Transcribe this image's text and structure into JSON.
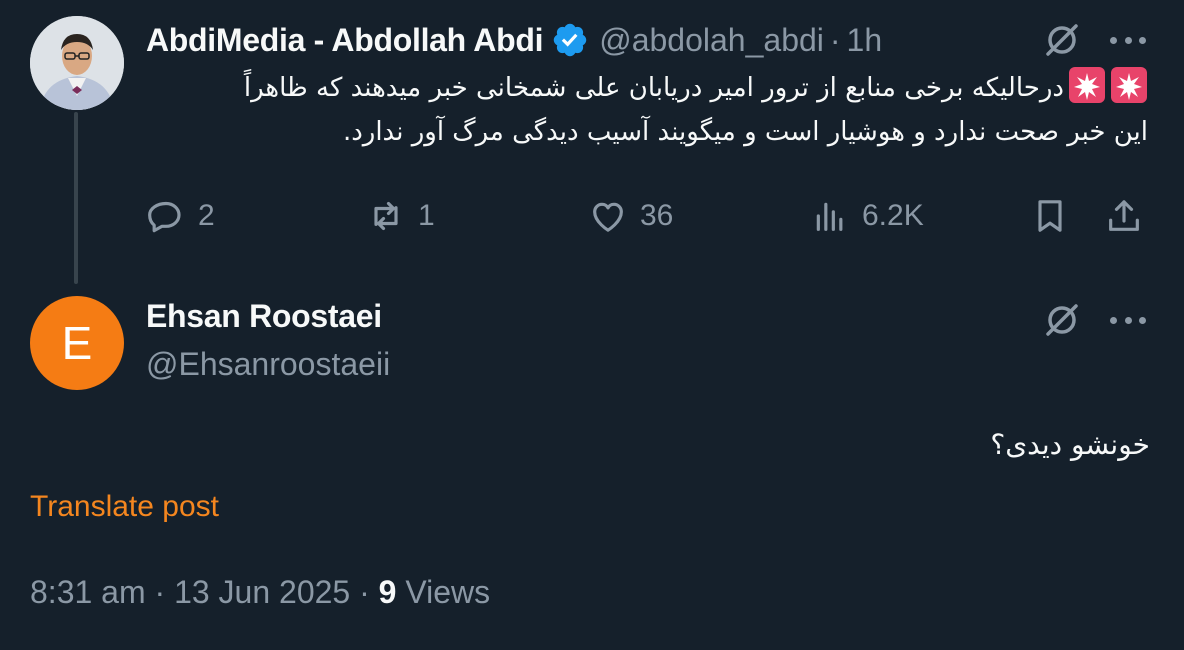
{
  "tweet": {
    "author_name": "AbdiMedia - Abdollah Abdi",
    "handle": "@abdolah_abdi",
    "separator": "·",
    "time": "1h",
    "text_line1": "درحالیکه برخی منابع از ترور امیر دریابان علی شمخانی خبر میدهند که ظاهراً",
    "text_line2": "این خبر صحت ندارد و  هوشیار است و میگویند آسیب دیدگی مرگ آور ندارد.",
    "emoji": "siren-emoji",
    "actions": {
      "replies": "2",
      "reposts": "1",
      "likes": "36",
      "views": "6.2K"
    }
  },
  "reply": {
    "avatar_letter": "E",
    "author_name": "Ehsan Roostaei",
    "handle": "@Ehsanroostaeii",
    "text": "خونشو دیدی؟",
    "translate_label": "Translate post",
    "timestamp": "8:31 am · 13 Jun 2025",
    "meta_separator": "·",
    "views_count": "9",
    "views_label": "Views"
  },
  "colors": {
    "background": "#15202b",
    "text": "#f7f9f9",
    "muted": "#8b98a5",
    "verified": "#1d9bf0",
    "translate": "#f4861f",
    "avatar": "#f57c14"
  }
}
